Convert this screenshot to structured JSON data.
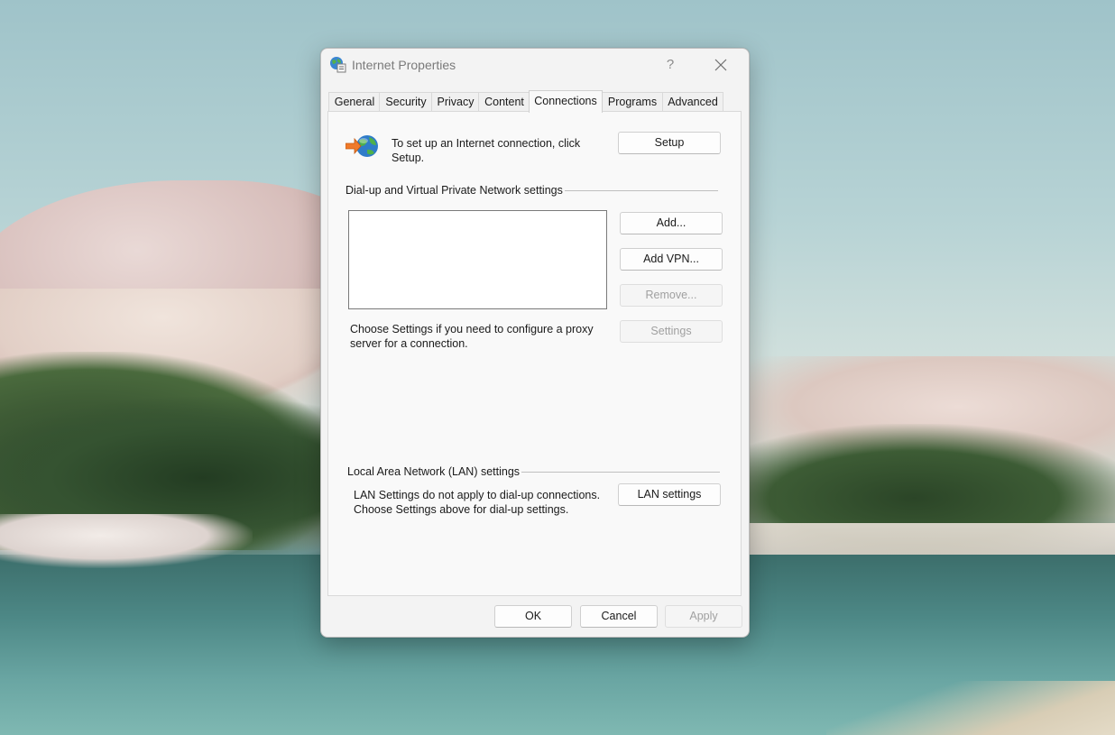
{
  "dialog": {
    "title": "Internet Properties",
    "help_glyph": "?",
    "close_icon": "close-icon"
  },
  "tabs": [
    {
      "label": "General",
      "active": false
    },
    {
      "label": "Security",
      "active": false
    },
    {
      "label": "Privacy",
      "active": false
    },
    {
      "label": "Content",
      "active": false
    },
    {
      "label": "Connections",
      "active": true
    },
    {
      "label": "Programs",
      "active": false
    },
    {
      "label": "Advanced",
      "active": false
    }
  ],
  "setup": {
    "icon": "internet-connection-wizard-icon",
    "text": "To set up an Internet connection, click Setup.",
    "button": "Setup"
  },
  "dialup": {
    "group_label": "Dial-up and Virtual Private Network settings",
    "connections": [],
    "add_button": "Add...",
    "add_vpn_button": "Add VPN...",
    "remove_button": "Remove...",
    "settings_button": "Settings",
    "proxy_text": "Choose Settings if you need to configure a proxy server for a connection."
  },
  "lan": {
    "group_label": "Local Area Network (LAN) settings",
    "text": "LAN Settings do not apply to dial-up connections. Choose Settings above for dial-up settings.",
    "button": "LAN settings"
  },
  "footer": {
    "ok": "OK",
    "cancel": "Cancel",
    "apply": "Apply"
  },
  "colors": {
    "dialog_bg": "#f3f3f3",
    "panel_bg": "#f9f9f9",
    "disabled_text": "#a0a0a0"
  }
}
